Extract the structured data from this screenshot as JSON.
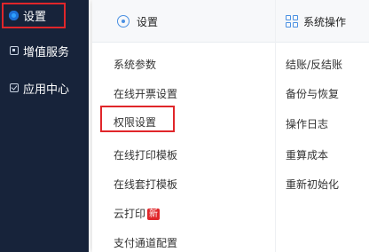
{
  "sidebar": {
    "items": [
      {
        "label": "设置",
        "icon": "settings-gear-icon",
        "active": true
      },
      {
        "label": "增值服务",
        "icon": "value-added-icon"
      },
      {
        "label": "应用中心",
        "icon": "app-center-icon"
      }
    ]
  },
  "panel": {
    "settings_column": {
      "title": "设置",
      "icon": "settings-circle-icon",
      "items": [
        "系统参数",
        "在线开票设置",
        "权限设置",
        "在线打印模板",
        "在线套打模板",
        "云打印",
        "支付通道配置"
      ],
      "new_badge": "新"
    },
    "system_column": {
      "title": "系统操作",
      "icon": "grid-icon",
      "items": [
        "结账/反结账",
        "备份与恢复",
        "操作日志",
        "重算成本",
        "重新初始化"
      ]
    }
  },
  "colors": {
    "sidebar_bg": "#17233a",
    "highlight": "#e0262a",
    "accent": "#4a90e2"
  }
}
